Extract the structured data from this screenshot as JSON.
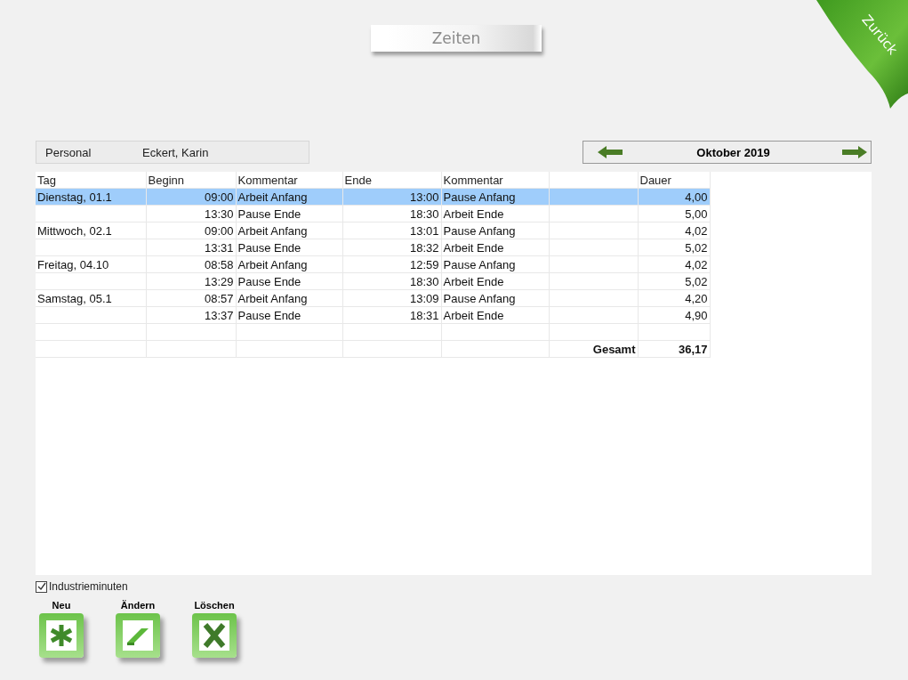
{
  "title": "Zeiten",
  "back": "Zurück",
  "personal": {
    "label": "Personal",
    "value": "Eckert, Karin"
  },
  "month": {
    "label": "Oktober 2019"
  },
  "table": {
    "columns": [
      "Tag",
      "Beginn",
      "Kommentar",
      "Ende",
      "Kommentar",
      "",
      "Dauer"
    ],
    "rows": [
      {
        "cells": [
          "Dienstag, 01.1",
          "09:00",
          "Arbeit Anfang",
          "13:00",
          "Pause Anfang",
          "",
          "4,00"
        ],
        "selected": true
      },
      {
        "cells": [
          "",
          "13:30",
          "Pause Ende",
          "18:30",
          "Arbeit Ende",
          "",
          "5,00"
        ],
        "selected": false
      },
      {
        "cells": [
          "Mittwoch, 02.1",
          "09:00",
          "Arbeit Anfang",
          "13:01",
          "Pause Anfang",
          "",
          "4,02"
        ],
        "selected": false
      },
      {
        "cells": [
          "",
          "13:31",
          "Pause Ende",
          "18:32",
          "Arbeit Ende",
          "",
          "5,02"
        ],
        "selected": false
      },
      {
        "cells": [
          "Freitag, 04.10",
          "08:58",
          "Arbeit Anfang",
          "12:59",
          "Pause Anfang",
          "",
          "4,02"
        ],
        "selected": false
      },
      {
        "cells": [
          "",
          "13:29",
          "Pause Ende",
          "18:30",
          "Arbeit Ende",
          "",
          "5,02"
        ],
        "selected": false
      },
      {
        "cells": [
          "Samstag, 05.1",
          "08:57",
          "Arbeit Anfang",
          "13:09",
          "Pause Anfang",
          "",
          "4,20"
        ],
        "selected": false
      },
      {
        "cells": [
          "",
          "13:37",
          "Pause Ende",
          "18:31",
          "Arbeit Ende",
          "",
          "4,90"
        ],
        "selected": false
      },
      {
        "cells": [
          "",
          "",
          "",
          "",
          "",
          "",
          ""
        ],
        "selected": false
      },
      {
        "cells": [
          "",
          "",
          "",
          "",
          "",
          "Gesamt",
          "36,17"
        ],
        "selected": false,
        "kind": "total"
      }
    ]
  },
  "industrieminuten": {
    "label": "Industrieminuten",
    "checked": true
  },
  "actions": [
    {
      "label": "Neu",
      "kind": "new"
    },
    {
      "label": "Ändern",
      "kind": "edit"
    },
    {
      "label": "Löschen",
      "kind": "delete"
    }
  ]
}
